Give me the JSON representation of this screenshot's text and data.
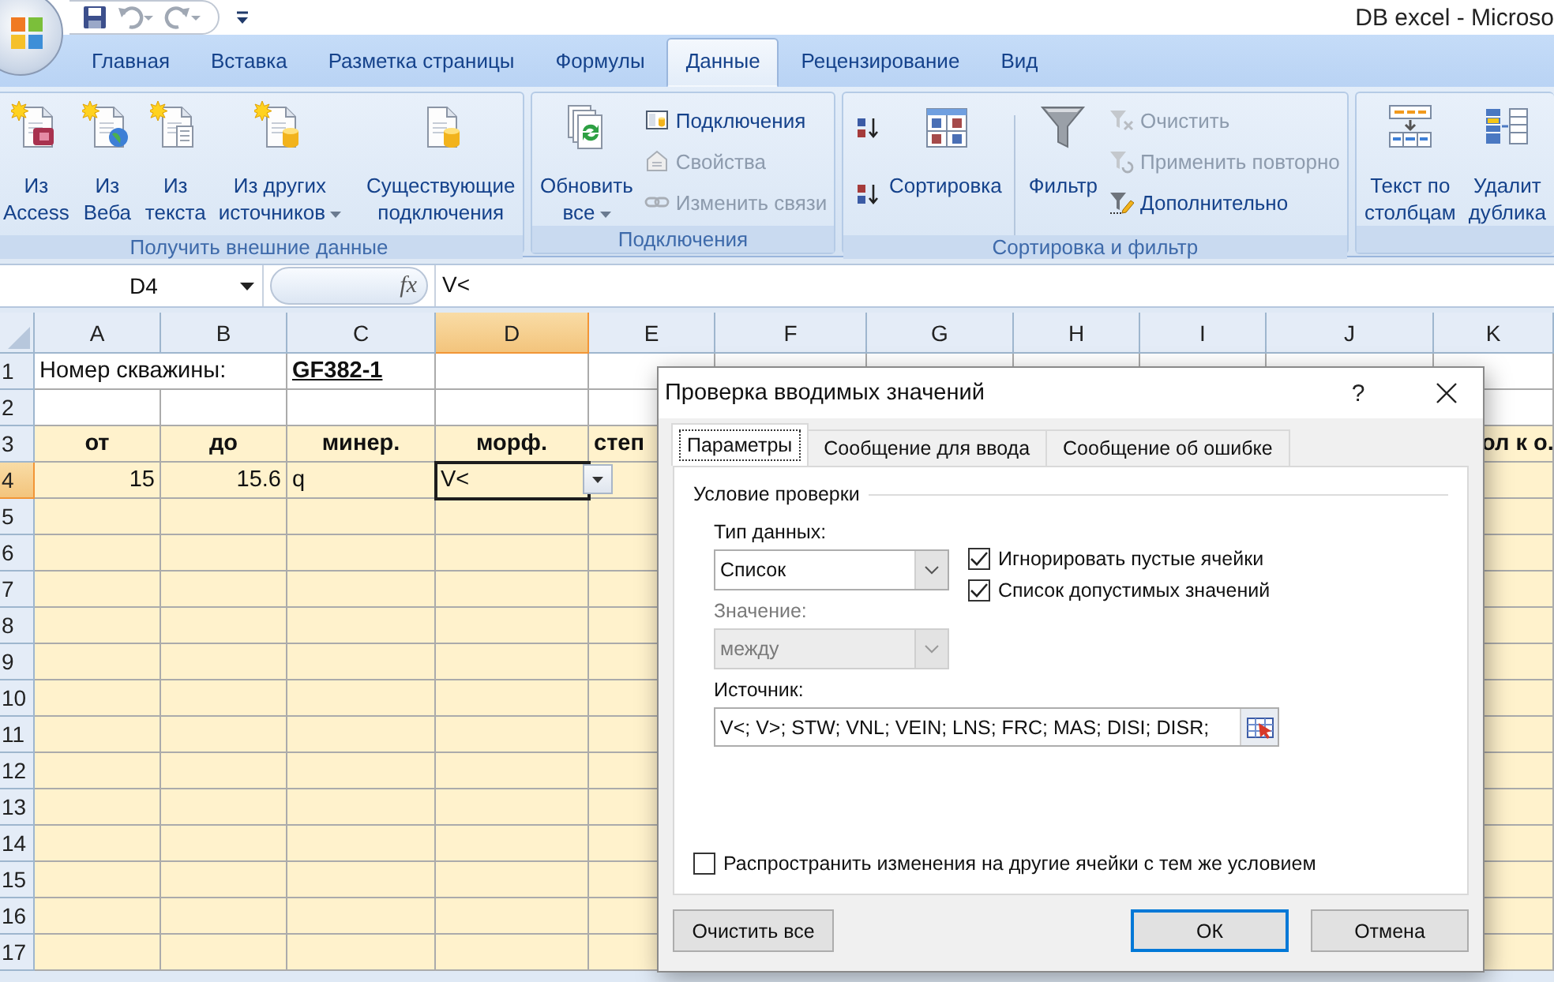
{
  "window": {
    "title": "DB excel - Microso"
  },
  "ribbon_tabs": [
    {
      "label": "Главная",
      "selected": false
    },
    {
      "label": "Вставка",
      "selected": false
    },
    {
      "label": "Разметка страницы",
      "selected": false
    },
    {
      "label": "Формулы",
      "selected": false
    },
    {
      "label": "Данные",
      "selected": true
    },
    {
      "label": "Рецензирование",
      "selected": false
    },
    {
      "label": "Вид",
      "selected": false
    }
  ],
  "ribbon_groups": [
    {
      "label": "Получить внешние данные",
      "items": [
        {
          "kind": "large",
          "lines": [
            "Из",
            "Access"
          ],
          "dropdown": false
        },
        {
          "kind": "large",
          "lines": [
            "Из",
            "Веба"
          ],
          "dropdown": false
        },
        {
          "kind": "large",
          "lines": [
            "Из",
            "текста"
          ],
          "dropdown": false
        },
        {
          "kind": "large",
          "lines": [
            "Из других",
            "источников"
          ],
          "dropdown": true
        },
        {
          "kind": "large",
          "lines": [
            "Существующие",
            "подключения"
          ],
          "dropdown": false
        }
      ]
    },
    {
      "label": "Подключения",
      "items": [
        {
          "kind": "large",
          "lines": [
            "Обновить",
            "все"
          ],
          "dropdown": true
        },
        {
          "kind": "small",
          "label": "Подключения",
          "disabled": false
        },
        {
          "kind": "small",
          "label": "Свойства",
          "disabled": true
        },
        {
          "kind": "small",
          "label": "Изменить связи",
          "disabled": true
        }
      ]
    },
    {
      "label": "Сортировка и фильтр",
      "items": [
        {
          "kind": "large",
          "lines": [
            "Сортировка"
          ],
          "dropdown": false
        },
        {
          "kind": "large",
          "lines": [
            "Фильтр"
          ],
          "dropdown": false
        },
        {
          "kind": "small",
          "label": "Очистить",
          "disabled": true
        },
        {
          "kind": "small",
          "label": "Применить повторно",
          "disabled": true
        },
        {
          "kind": "small",
          "label": "Дополнительно",
          "disabled": false
        }
      ]
    },
    {
      "items": [
        {
          "kind": "large",
          "lines": [
            "Текст по",
            "столбцам"
          ],
          "dropdown": false
        },
        {
          "kind": "large",
          "lines": [
            "Удалит",
            "дублика"
          ],
          "dropdown": false
        }
      ]
    }
  ],
  "formula_bar": {
    "name_box": "D4",
    "fx": "fx",
    "value": "V<"
  },
  "columns": [
    {
      "label": "A",
      "selected": false
    },
    {
      "label": "B",
      "selected": false
    },
    {
      "label": "C",
      "selected": false
    },
    {
      "label": "D",
      "selected": true
    },
    {
      "label": "E",
      "selected": false
    },
    {
      "label": "F",
      "selected": false
    },
    {
      "label": "G",
      "selected": false
    },
    {
      "label": "H",
      "selected": false
    },
    {
      "label": "I",
      "selected": false
    },
    {
      "label": "J",
      "selected": false
    },
    {
      "label": "K",
      "selected": false
    }
  ],
  "rows": [
    {
      "label": "1",
      "selected": false,
      "shaded": false,
      "cells": [
        {
          "kind": "label_wide",
          "text": "Номер скважины:",
          "selected": false
        },
        null,
        {
          "kind": "title",
          "text": "GF382-1",
          "selected": false
        },
        null,
        null,
        null,
        null,
        null,
        null,
        null,
        null
      ]
    },
    {
      "label": "2",
      "selected": false,
      "shaded": false
    },
    {
      "label": "3",
      "selected": false,
      "shaded": true,
      "cells": [
        {
          "kind": "heading",
          "text": "от",
          "selected": false
        },
        {
          "kind": "heading",
          "text": "до",
          "selected": false
        },
        {
          "kind": "heading",
          "text": "минер.",
          "selected": false
        },
        {
          "kind": "heading",
          "text": "морф.",
          "selected": false
        },
        {
          "kind": "heading_left",
          "text": "степ",
          "selected": false
        },
        null,
        null,
        null,
        null,
        null,
        {
          "kind": "heading_tail",
          "text": "ол к о.",
          "selected": false
        }
      ]
    },
    {
      "label": "4",
      "selected": true,
      "shaded": true,
      "cells": [
        {
          "kind": "number",
          "text": "15",
          "selected": false
        },
        {
          "kind": "number",
          "text": "15.6",
          "selected": false
        },
        {
          "kind": "label",
          "text": "q",
          "selected": false
        },
        {
          "kind": "label",
          "text": "V<",
          "selected": true
        },
        null,
        null,
        null,
        null,
        null,
        null,
        null
      ]
    },
    {
      "label": "5",
      "selected": false,
      "shaded": true
    },
    {
      "label": "6",
      "selected": false,
      "shaded": true
    },
    {
      "label": "7",
      "selected": false,
      "shaded": true
    },
    {
      "label": "8",
      "selected": false,
      "shaded": true
    },
    {
      "label": "9",
      "selected": false,
      "shaded": true
    },
    {
      "label": "10",
      "selected": false,
      "shaded": true
    },
    {
      "label": "11",
      "selected": false,
      "shaded": true
    },
    {
      "label": "12",
      "selected": false,
      "shaded": true
    },
    {
      "label": "13",
      "selected": false,
      "shaded": true
    },
    {
      "label": "14",
      "selected": false,
      "shaded": true
    },
    {
      "label": "15",
      "selected": false,
      "shaded": true
    },
    {
      "label": "16",
      "selected": false,
      "shaded": true
    },
    {
      "label": "17",
      "selected": false,
      "shaded": true
    }
  ],
  "dialog": {
    "title": "Проверка вводимых значений",
    "help": "?",
    "tabs": [
      {
        "label": "Параметры",
        "selected": true
      },
      {
        "label": "Сообщение для ввода",
        "selected": false
      },
      {
        "label": "Сообщение об ошибке",
        "selected": false
      }
    ],
    "section": "Условие проверки",
    "data_type": {
      "label": "Тип данных:",
      "value": "Список",
      "disabled": false
    },
    "value_field": {
      "label": "Значение:",
      "value": "между",
      "disabled": true
    },
    "checkboxes": [
      {
        "label": "Игнорировать пустые ячейки",
        "checked": true
      },
      {
        "label": "Список допустимых значений",
        "checked": true
      }
    ],
    "source": {
      "label": "Источник:",
      "value": "V<; V>; STW; VNL; VEIN; LNS; FRC; MAS; DISI; DISR;"
    },
    "apply_all": {
      "label": "Распространить изменения на другие ячейки с тем же условием",
      "checked": false
    },
    "buttons": [
      {
        "label": "Очистить все",
        "default": false
      },
      {
        "label": "ОК",
        "default": true
      },
      {
        "label": "Отмена",
        "default": false
      }
    ]
  }
}
